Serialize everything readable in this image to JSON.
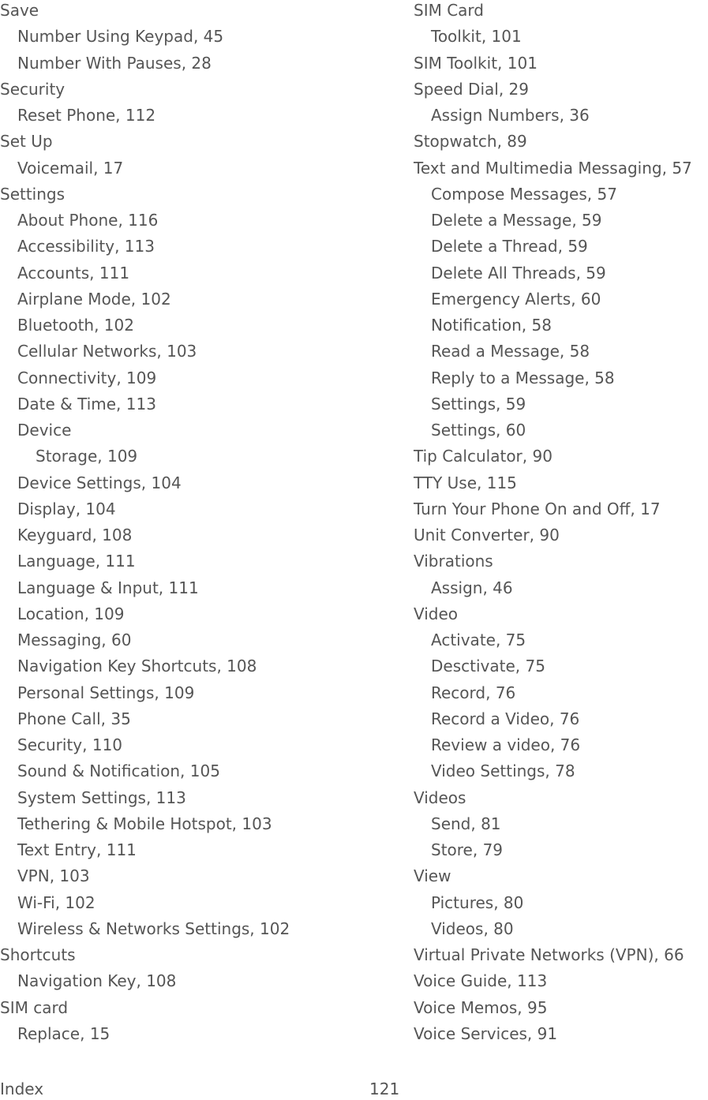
{
  "left_column": [
    {
      "text": "Save",
      "level": 0
    },
    {
      "text": "Number Using Keypad, 45",
      "level": 1
    },
    {
      "text": "Number With Pauses, 28",
      "level": 1
    },
    {
      "text": "Security",
      "level": 0
    },
    {
      "text": "Reset Phone, 112",
      "level": 1
    },
    {
      "text": "Set Up",
      "level": 0
    },
    {
      "text": "Voicemail, 17",
      "level": 1
    },
    {
      "text": "Settings",
      "level": 0
    },
    {
      "text": "About Phone, 116",
      "level": 1
    },
    {
      "text": "Accessibility, 113",
      "level": 1
    },
    {
      "text": "Accounts, 111",
      "level": 1
    },
    {
      "text": "Airplane Mode, 102",
      "level": 1
    },
    {
      "text": "Bluetooth, 102",
      "level": 1
    },
    {
      "text": "Cellular Networks, 103",
      "level": 1
    },
    {
      "text": "Connectivity, 109",
      "level": 1
    },
    {
      "text": "Date & Time, 113",
      "level": 1
    },
    {
      "text": "Device",
      "level": 1
    },
    {
      "text": "Storage, 109",
      "level": 2
    },
    {
      "text": "Device Settings, 104",
      "level": 1
    },
    {
      "text": "Display, 104",
      "level": 1
    },
    {
      "text": "Keyguard, 108",
      "level": 1
    },
    {
      "text": "Language, 111",
      "level": 1
    },
    {
      "text": "Language & Input, 111",
      "level": 1
    },
    {
      "text": "Location, 109",
      "level": 1
    },
    {
      "text": "Messaging, 60",
      "level": 1
    },
    {
      "text": "Navigation Key Shortcuts, 108",
      "level": 1
    },
    {
      "text": "Personal Settings, 109",
      "level": 1
    },
    {
      "text": "Phone Call, 35",
      "level": 1
    },
    {
      "text": "Security, 110",
      "level": 1
    },
    {
      "text": "Sound & Notification, 105",
      "level": 1
    },
    {
      "text": "System Settings, 113",
      "level": 1
    },
    {
      "text": "Tethering & Mobile Hotspot, 103",
      "level": 1
    },
    {
      "text": "Text Entry, 111",
      "level": 1
    },
    {
      "text": "VPN, 103",
      "level": 1
    },
    {
      "text": "Wi-Fi, 102",
      "level": 1
    },
    {
      "text": "Wireless & Networks Settings, 102",
      "level": 1
    },
    {
      "text": "Shortcuts",
      "level": 0
    },
    {
      "text": "Navigation Key, 108",
      "level": 1
    },
    {
      "text": "SIM card",
      "level": 0
    },
    {
      "text": "Replace, 15",
      "level": 1
    }
  ],
  "right_column": [
    {
      "text": "SIM Card",
      "level": 0
    },
    {
      "text": "Toolkit, 101",
      "level": 1
    },
    {
      "text": "SIM Toolkit, 101",
      "level": 0
    },
    {
      "text": "Speed Dial, 29",
      "level": 0
    },
    {
      "text": "Assign Numbers, 36",
      "level": 1
    },
    {
      "text": "Stopwatch, 89",
      "level": 0
    },
    {
      "text": "Text and Multimedia Messaging, 57",
      "level": 0
    },
    {
      "text": "Compose Messages, 57",
      "level": 1
    },
    {
      "text": "Delete a Message, 59",
      "level": 1
    },
    {
      "text": "Delete a Thread, 59",
      "level": 1
    },
    {
      "text": "Delete All Threads, 59",
      "level": 1
    },
    {
      "text": "Emergency Alerts, 60",
      "level": 1
    },
    {
      "text": "Notification, 58",
      "level": 1
    },
    {
      "text": "Read a Message, 58",
      "level": 1
    },
    {
      "text": "Reply to a Message, 58",
      "level": 1
    },
    {
      "text": "Settings, 59",
      "level": 1
    },
    {
      "text": "Settings, 60",
      "level": 1
    },
    {
      "text": "Tip Calculator, 90",
      "level": 0
    },
    {
      "text": "TTY Use, 115",
      "level": 0
    },
    {
      "text": "Turn Your Phone On and Off, 17",
      "level": 0
    },
    {
      "text": "Unit Converter, 90",
      "level": 0
    },
    {
      "text": "Vibrations",
      "level": 0
    },
    {
      "text": "Assign, 46",
      "level": 1
    },
    {
      "text": "Video",
      "level": 0
    },
    {
      "text": "Activate, 75",
      "level": 1
    },
    {
      "text": "Desctivate, 75",
      "level": 1
    },
    {
      "text": "Record, 76",
      "level": 1
    },
    {
      "text": "Record a Video, 76",
      "level": 1
    },
    {
      "text": "Review a video, 76",
      "level": 1
    },
    {
      "text": "Video Settings, 78",
      "level": 1
    },
    {
      "text": "Videos",
      "level": 0
    },
    {
      "text": "Send, 81",
      "level": 1
    },
    {
      "text": "Store, 79",
      "level": 1
    },
    {
      "text": "View",
      "level": 0
    },
    {
      "text": "Pictures, 80",
      "level": 1
    },
    {
      "text": "Videos, 80",
      "level": 1
    },
    {
      "text": "Virtual Private Networks (VPN), 66",
      "level": 0
    },
    {
      "text": "Voice Guide, 113",
      "level": 0
    },
    {
      "text": "Voice Memos, 95",
      "level": 0
    },
    {
      "text": "Voice Services, 91",
      "level": 0
    }
  ],
  "footer": {
    "section": "Index",
    "page_number": "121"
  },
  "colors": {
    "text": "#555555",
    "background": "#ffffff"
  }
}
